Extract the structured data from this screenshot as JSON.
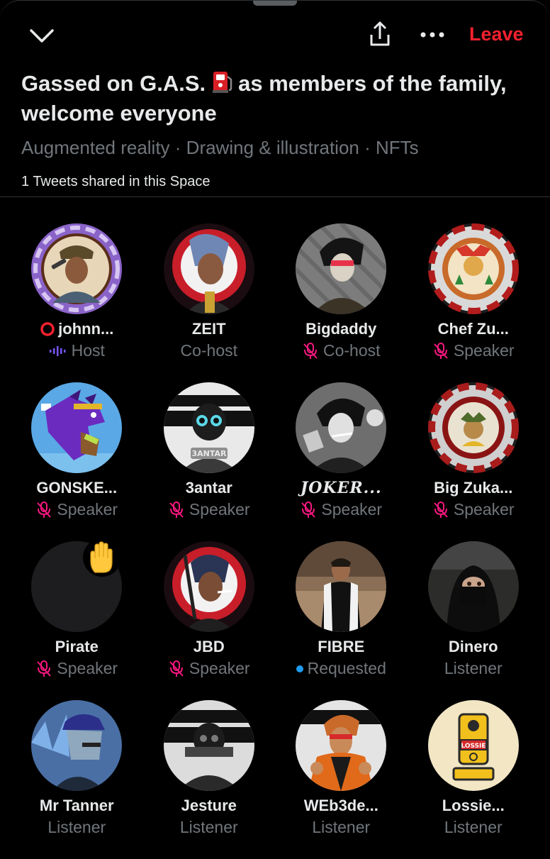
{
  "header": {
    "leave_label": "Leave",
    "title_part1": "Gassed on G.A.S.",
    "title_part2": "as members of the family, welcome everyone",
    "topics": "Augmented reality · Drawing & illustration · NFTs",
    "tweets_shared": "1 Tweets shared in this Space"
  },
  "participants": [
    {
      "name": "johnn...",
      "role": "Host"
    },
    {
      "name": "ZEIT",
      "role": "Co-host"
    },
    {
      "name": "Bigdaddy",
      "role": "Co-host"
    },
    {
      "name": "Chef Zu...",
      "role": "Speaker"
    },
    {
      "name": "GONSKE...",
      "role": "Speaker"
    },
    {
      "name": "3antar",
      "role": "Speaker"
    },
    {
      "name": "JOKER...",
      "role": "Speaker"
    },
    {
      "name": "Big Zuka...",
      "role": "Speaker"
    },
    {
      "name": "Pirate",
      "role": "Speaker"
    },
    {
      "name": "JBD",
      "role": "Speaker"
    },
    {
      "name": "FIBRE",
      "role": "Requested"
    },
    {
      "name": "Dinero",
      "role": "Listener"
    },
    {
      "name": "Mr Tanner",
      "role": "Listener"
    },
    {
      "name": "Jesture",
      "role": "Listener"
    },
    {
      "name": "WEb3de...",
      "role": "Listener"
    },
    {
      "name": "Lossie...",
      "role": "Listener"
    }
  ],
  "avatar_text": {
    "3antar": "3ANTAR",
    "lossie": "LOSSIE"
  },
  "colors": {
    "leave": "#f4212e",
    "muted_mic": "#f91880",
    "requested_dot": "#1d9bf0",
    "host_wave": "#7856ff",
    "secondary_text": "#71767b"
  }
}
